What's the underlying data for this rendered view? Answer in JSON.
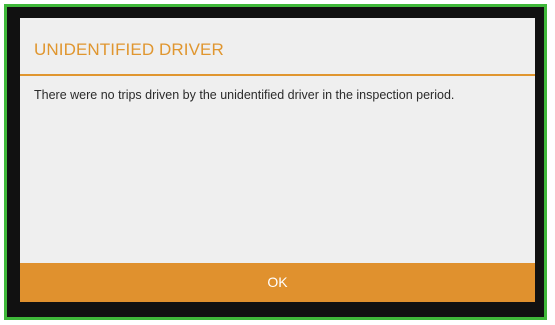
{
  "dialog": {
    "title": "UNIDENTIFIED DRIVER",
    "message": "There were no trips driven by the unidentified driver in the inspection period.",
    "ok_label": "OK"
  },
  "colors": {
    "accent": "#e0962f",
    "button": "#e0912e",
    "frame_border": "#3fb83a",
    "dialog_bg": "#efefef"
  }
}
